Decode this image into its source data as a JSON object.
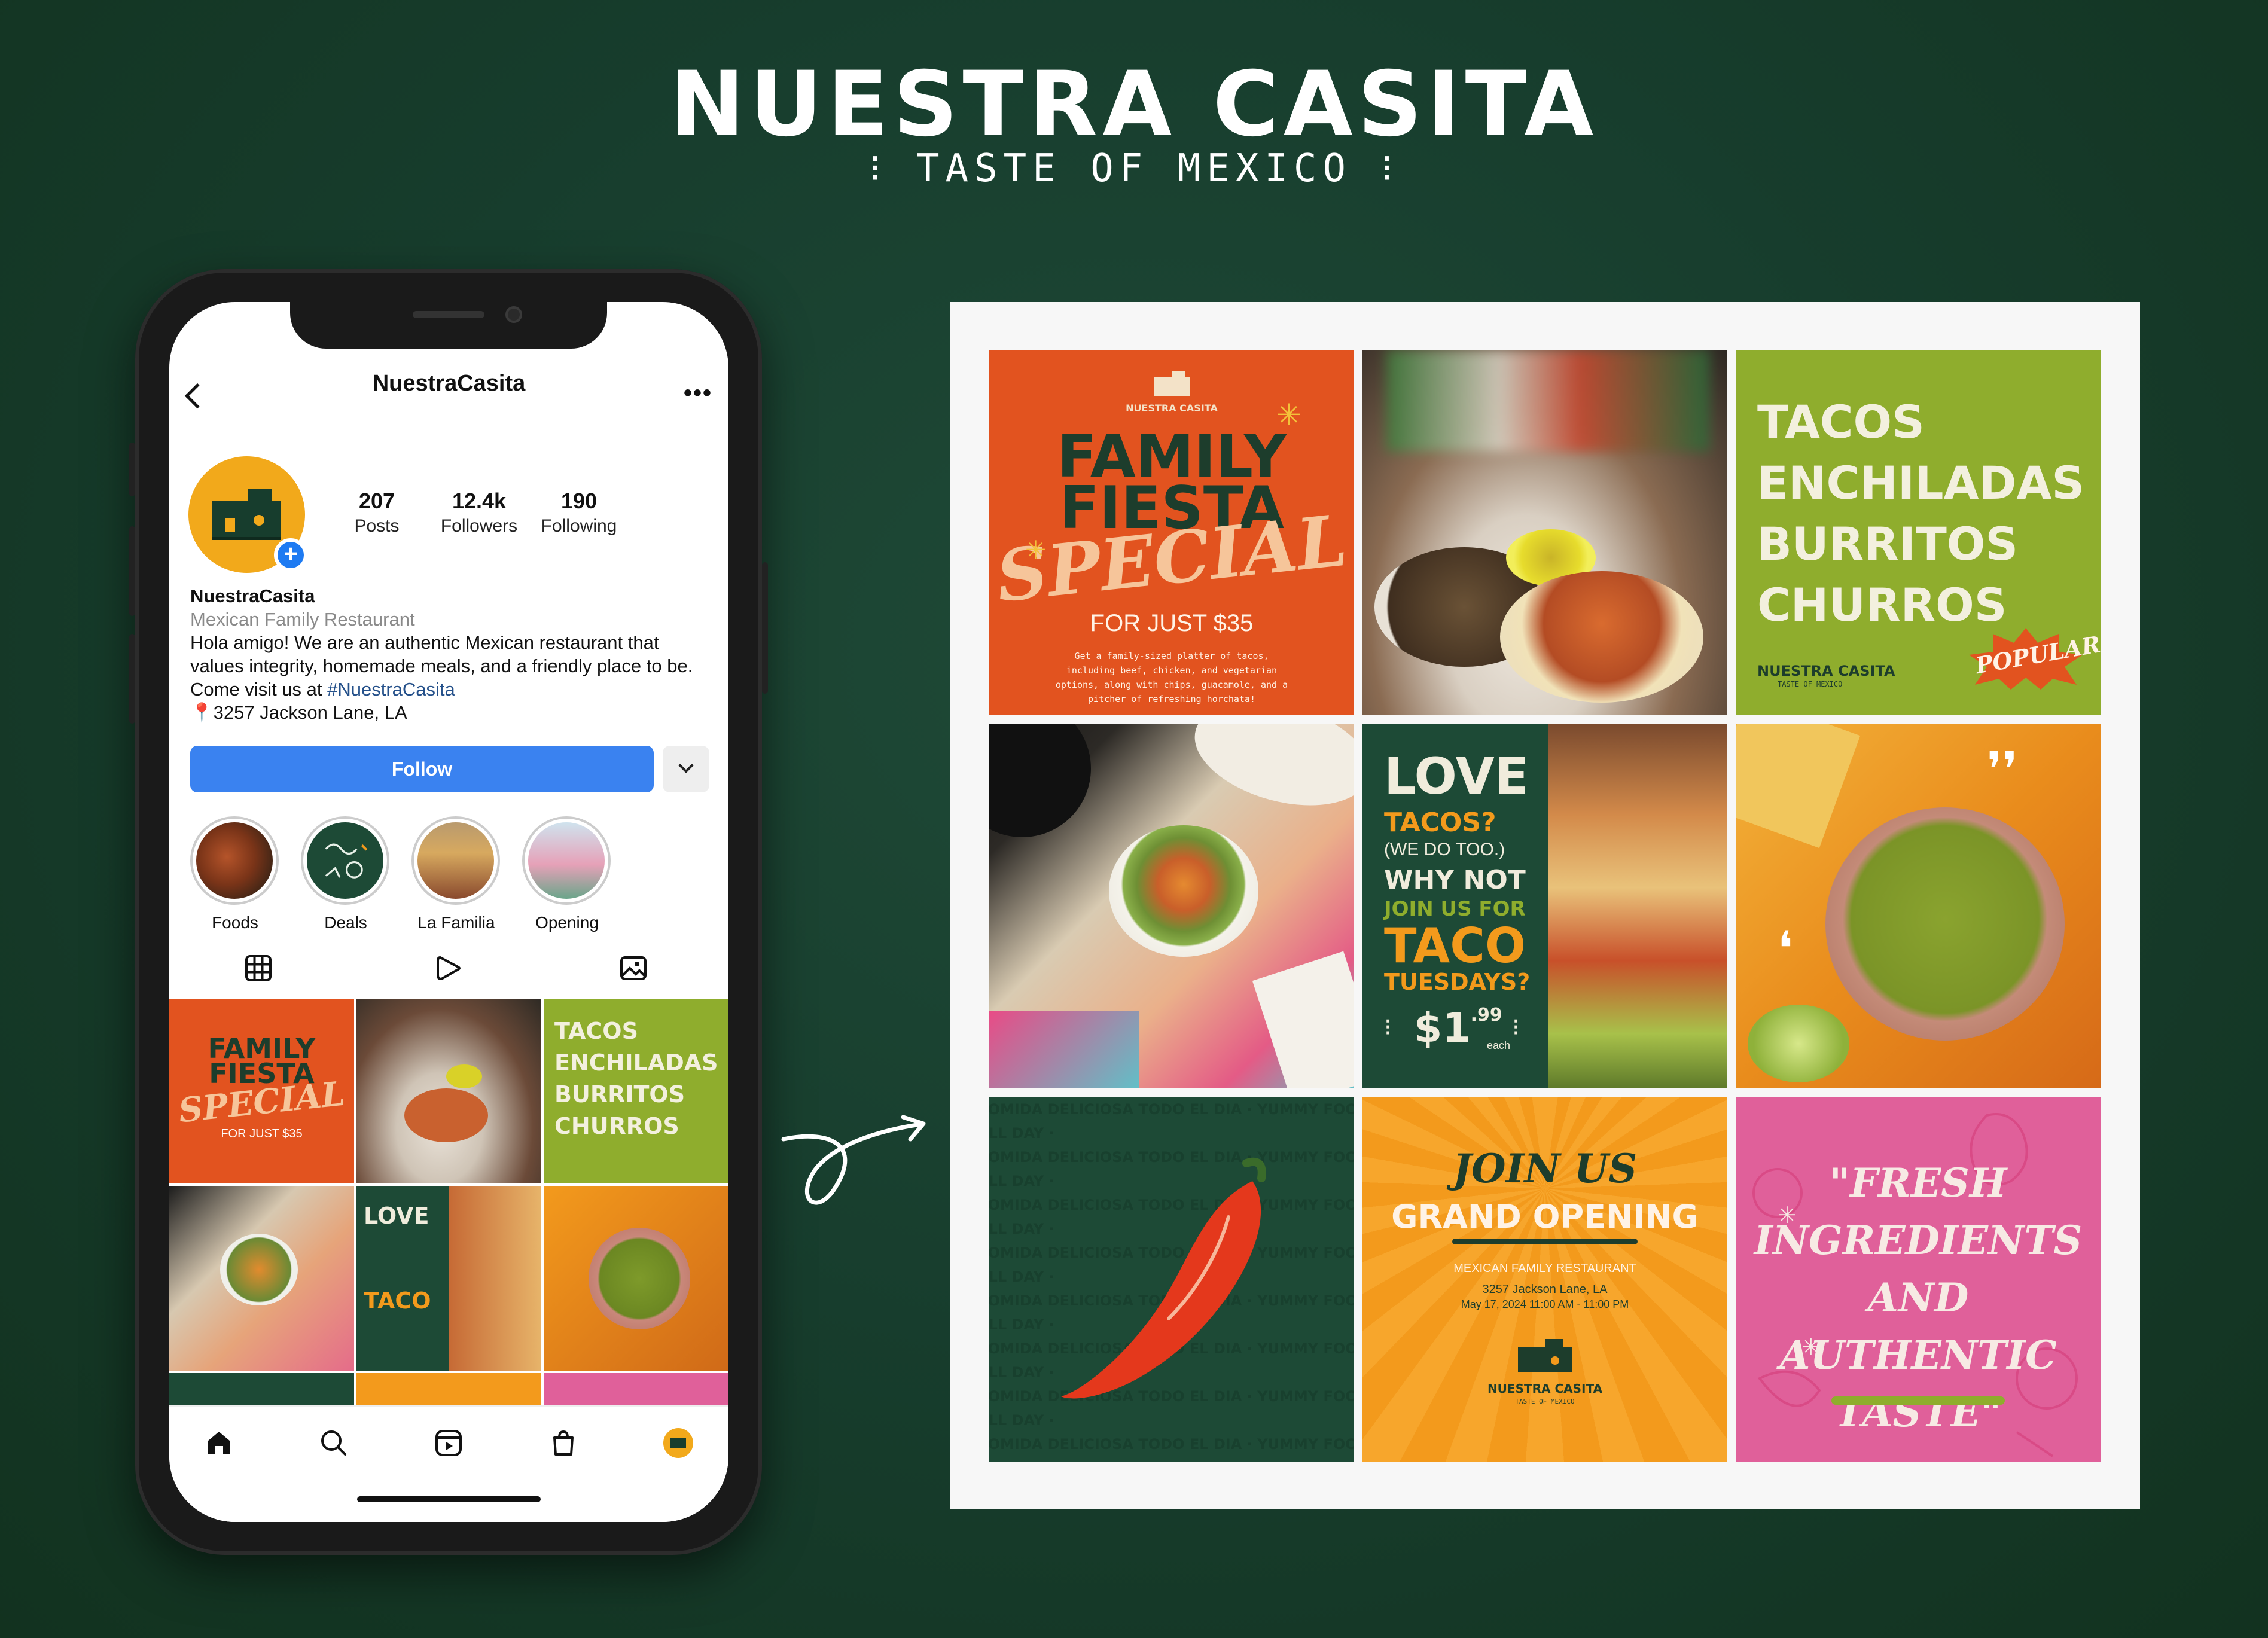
{
  "brand": {
    "title": "NUESTRA CASITA",
    "subtitle": "TASTE OF MEXICO"
  },
  "profile": {
    "username": "NuestraCasita",
    "stats": [
      {
        "value": "207",
        "label": "Posts"
      },
      {
        "value": "12.4k",
        "label": "Followers"
      },
      {
        "value": "190",
        "label": "Following"
      }
    ],
    "name": "NuestraCasita",
    "category": "Mexican Family Restaurant",
    "bio_text": "Hola amigo! We are an authentic Mexican restaurant that values integrity, homemade meals, and a friendly place to be. Come visit us at ",
    "bio_hashtag": "#NuestraCasita",
    "location_icon": "pin-icon",
    "location": "3257 Jackson Lane, LA",
    "follow_label": "Follow",
    "highlights": [
      {
        "label": "Foods"
      },
      {
        "label": "Deals"
      },
      {
        "label": "La Familia"
      },
      {
        "label": "Opening"
      }
    ]
  },
  "posts": {
    "family_brand": "NUESTRA CASITA",
    "family_brand_sub": "TASTE OF MEXICO",
    "family_line1": "FAMILY",
    "family_line2": "FIESTA",
    "family_line3": "SPECIAL",
    "family_price": "FOR JUST $35",
    "family_desc": "Get a family-sized platter of tacos, including beef, chicken, and vegetarian options, along with chips, guacamole, and a pitcher of refreshing horchata!",
    "menu_items": [
      "TACOS",
      "ENCHILADAS",
      "BURRITOS",
      "CHURROS"
    ],
    "menu_brand": "NUESTRA CASITA",
    "menu_brand_sub": "TASTE OF MEXICO",
    "menu_badge": "POPULAR!",
    "love_1": "LOVE",
    "love_2": "TACOS?",
    "love_3": "(WE DO TOO.)",
    "love_4": "WHY NOT",
    "love_5": "JOIN US FOR",
    "love_6": "TACO",
    "love_7": "TUESDAYS?",
    "love_price": "$1",
    "love_cents": ".99",
    "love_each": "each",
    "pattern_text": "COMIDA DELICIOSA TODO EL DIA · YUMMY FOOD ALL DAY · ",
    "opening_1": "JOIN US",
    "opening_2": "GRAND OPENING",
    "opening_3": "MEXICAN FAMILY RESTAURANT",
    "opening_4": "3257 Jackson Lane, LA",
    "opening_5": "May 17, 2024 11:00 AM - 11:00 PM",
    "opening_brand": "NUESTRA CASITA",
    "opening_brand_sub": "TASTE OF MEXICO",
    "quote_1": "\"FRESH",
    "quote_2": "INGREDIENTS",
    "quote_3": "AND AUTHENTIC",
    "quote_4": "TASTE\""
  },
  "colors": {
    "background": "#173d2d",
    "orange_red": "#e2531f",
    "lime": "#8fad2d",
    "dark_green": "#1d4a36",
    "orange": "#f39a1c",
    "pink": "#e0609a",
    "ig_blue": "#3a82f0"
  }
}
